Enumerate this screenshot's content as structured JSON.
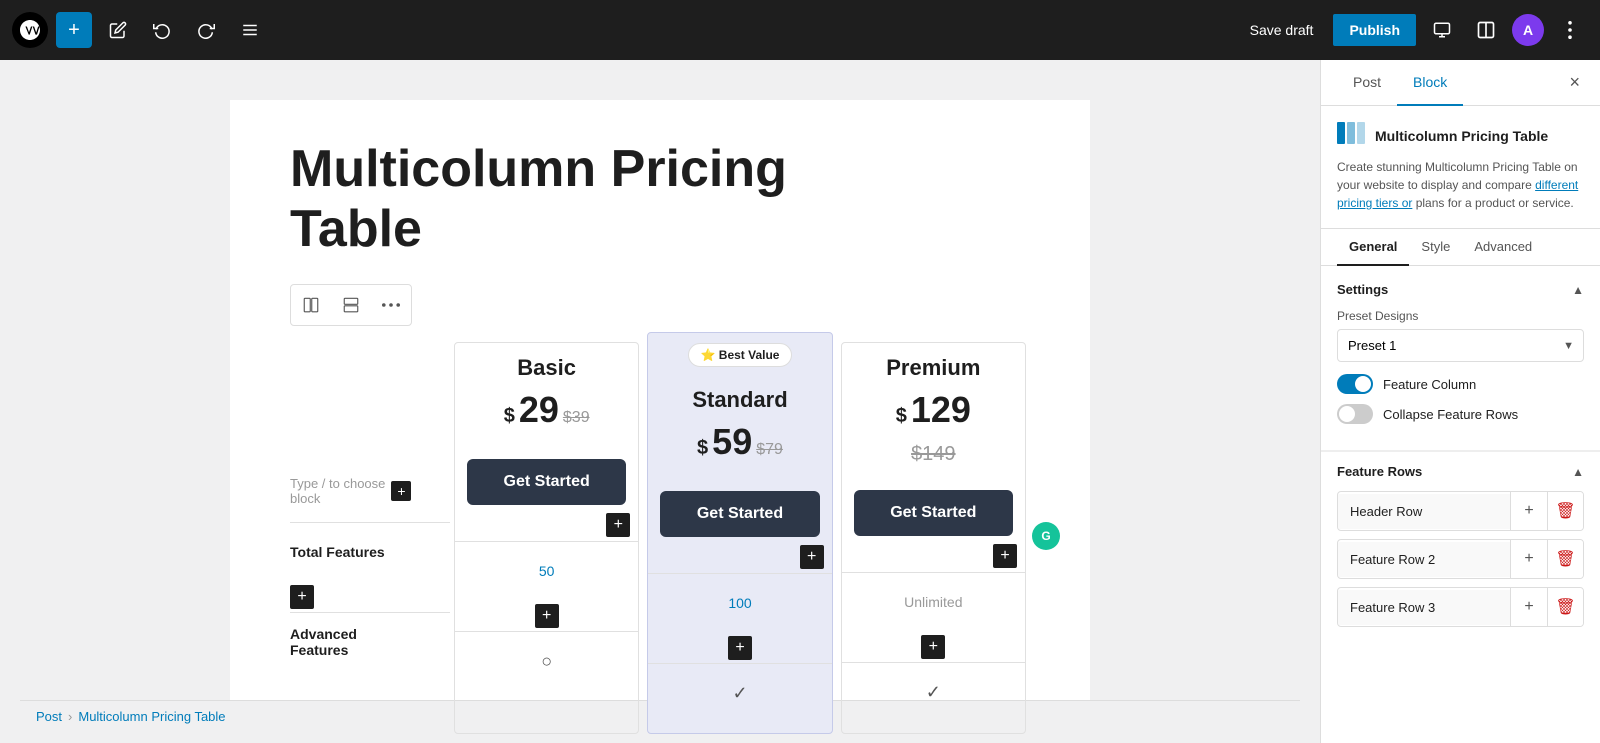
{
  "toolbar": {
    "add_label": "+",
    "save_draft_label": "Save draft",
    "publish_label": "Publish",
    "user_initial": "A"
  },
  "page": {
    "title": "Multicolumn Pricing\nTable"
  },
  "block_toolbar": {
    "view1": "⊞",
    "view2": "⊟",
    "more": "⋮"
  },
  "feature_col": {
    "type_to_choose": "Type / to choose block",
    "rows": [
      {
        "label": "Total Features"
      },
      {
        "label": "Advanced\nFeatures"
      }
    ]
  },
  "pricing_columns": [
    {
      "id": "basic",
      "name": "Basic",
      "price": "29",
      "original_price": "$39",
      "cta": "Get Started",
      "features": [
        "50",
        ""
      ],
      "featured": false,
      "badge": null,
      "show_original_above": false
    },
    {
      "id": "standard",
      "name": "Standard",
      "price": "59",
      "original_price": "$79",
      "cta": "Get Started",
      "features": [
        "100",
        ""
      ],
      "featured": true,
      "badge": "⭐ Best Value",
      "show_original_above": false
    },
    {
      "id": "premium",
      "name": "Premium",
      "price": "129",
      "original_price": "$149",
      "cta": "Get Started",
      "features": [
        "Unlimited",
        ""
      ],
      "featured": false,
      "badge": null,
      "show_original_above": true
    }
  ],
  "sidebar": {
    "tabs": [
      "Post",
      "Block"
    ],
    "active_tab": "Block",
    "close_label": "×",
    "block_name": "Multicolumn Pricing Table",
    "block_description": "Create stunning Multicolumn Pricing Table on your website to display and compare",
    "block_description_link": "different pricing tiers or",
    "block_description_end": "plans for a product or service.",
    "sub_tabs": [
      "General",
      "Style",
      "Advanced"
    ],
    "active_sub_tab": "General",
    "settings": {
      "section_title": "Settings",
      "preset_label": "Preset Designs",
      "preset_value": "Preset 1",
      "feature_column_label": "Feature Column",
      "feature_column_on": true,
      "collapse_rows_label": "Collapse Feature Rows",
      "collapse_rows_on": false
    },
    "feature_rows": {
      "section_title": "Feature Rows",
      "rows": [
        {
          "label": "Header Row"
        },
        {
          "label": "Feature Row 2"
        },
        {
          "label": "Feature Row 3"
        }
      ]
    }
  },
  "breadcrumb": {
    "root": "Post",
    "current": "Multicolumn Pricing Table"
  }
}
